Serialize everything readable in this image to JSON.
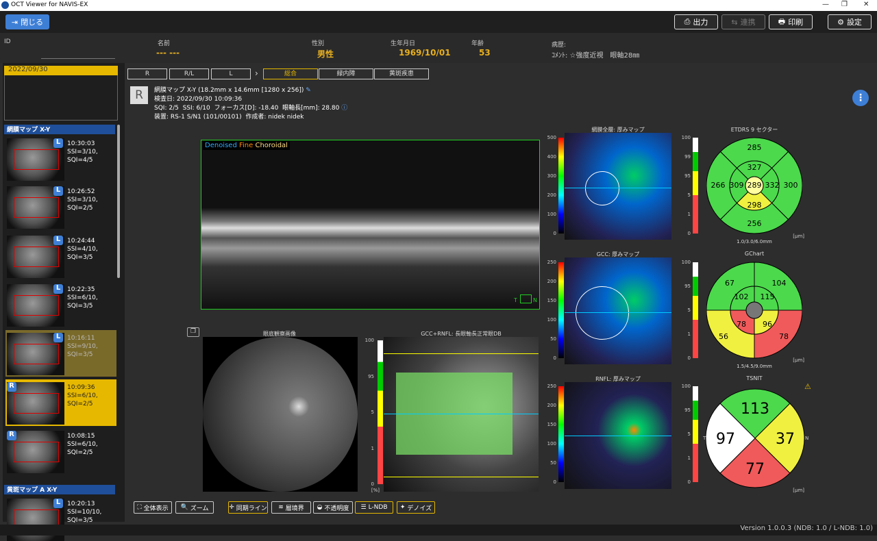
{
  "window": {
    "title": "OCT Viewer for NAVIS-EX"
  },
  "toolbar": {
    "close": "閉じる",
    "output": "出力",
    "link": "連携",
    "print": "印刷",
    "settings": "設定"
  },
  "patient": {
    "id_label": "ID",
    "name_label": "名前",
    "name": "--- ---",
    "sex_label": "性別",
    "sex": "男性",
    "dob_label": "生年月日",
    "dob": "1969/10/01",
    "age_label": "年齢",
    "age": "53",
    "history_label": "病歴:",
    "comment": "ｺﾒﾝﾄ: ☆強度近視　眼軸28㎜"
  },
  "sidebar": {
    "date": "2022/09/30",
    "section1": "網膜マップ X-Y",
    "section2": "黄斑マップ A X-Y",
    "thumbs": [
      {
        "eye": "L",
        "time": "10:30:03",
        "ssi": "SSI=3/10,",
        "sqi": "SQI=4/5"
      },
      {
        "eye": "L",
        "time": "10:26:52",
        "ssi": "SSI=3/10,",
        "sqi": "SQI=2/5"
      },
      {
        "eye": "L",
        "time": "10:24:44",
        "ssi": "SSI=4/10,",
        "sqi": "SQI=3/5"
      },
      {
        "eye": "L",
        "time": "10:22:35",
        "ssi": "SSI=6/10,",
        "sqi": "SQI=3/5"
      },
      {
        "eye": "L",
        "time": "10:16:11",
        "ssi": "SSI=9/10,",
        "sqi": "SQI=3/5"
      },
      {
        "eye": "R",
        "time": "10:09:36",
        "ssi": "SSI=6/10,",
        "sqi": "SQI=2/5"
      },
      {
        "eye": "R",
        "time": "10:08:15",
        "ssi": "SSI=6/10,",
        "sqi": "SQI=2/5"
      },
      {
        "eye": "L",
        "time": "10:20:13",
        "ssi": "SSI=10/10,",
        "sqi": "SQI=3/5"
      }
    ]
  },
  "tabs": {
    "r": "R",
    "rl": "R/L",
    "l": "L",
    "sep": "›",
    "summary": "総合",
    "glaucoma": "緑内障",
    "macula": "黄斑疾患"
  },
  "scan": {
    "eye": "R",
    "title": "網膜マップ X-Y (18.2mm x 14.6mm [1280 x 256])",
    "date": "検査日: 2022/09/30 10:09:36",
    "q1": "SQI: 2/5",
    "q2": "SSI: 6/10",
    "q3": "フォーカス[D]: -18.40",
    "q4": "眼軸長[mm]: 28.80",
    "device": "装置: RS-1 S/N1 (101/00101)",
    "author": "作成者: nidek nidek"
  },
  "bscan": {
    "t1": "Denoised",
    "t2": "Fine",
    "t3": "Choroidal",
    "t_label": "T",
    "n_label": "N"
  },
  "panels": {
    "fundus": "眼底観察画像",
    "gcc_rnfl": "GCC+RNFL: 長眼軸長正常眼DB",
    "full": "網膜全層: 厚みマップ",
    "gcc": "GCC: 厚みマップ",
    "rnfl": "RNFL: 厚みマップ",
    "etdrs": "ETDRS 9 セクター",
    "gchart": "GChart",
    "tsnit": "TSNIT"
  },
  "ticks": {
    "full": [
      "500",
      "400",
      "300",
      "200",
      "100",
      "0"
    ],
    "gcc": [
      "250",
      "200",
      "150",
      "100",
      "50",
      "0"
    ],
    "rnfl": [
      "250",
      "200",
      "150",
      "100",
      "50",
      "0"
    ],
    "pct": [
      "100",
      "99",
      "95",
      "5",
      "1",
      "0"
    ],
    "pct2": [
      "100",
      "95",
      "5",
      "1",
      "0"
    ],
    "um": "[μm]",
    "pc": "[%]"
  },
  "etdrs": {
    "values": [
      "285",
      "327",
      "266",
      "309",
      "289",
      "332",
      "300",
      "298",
      "256"
    ],
    "note": "1.0/3.0/6.0mm",
    "unit": "[μm]"
  },
  "gchart": {
    "values": [
      "67",
      "104",
      "102",
      "115",
      "78",
      "96",
      "56",
      "78"
    ],
    "note": "1.5/4.5/9.0mm",
    "unit": "[μm]"
  },
  "tsnit": {
    "values": [
      "113",
      "97",
      "37",
      "77"
    ],
    "t": "T",
    "n": "N",
    "unit": "[μm]"
  },
  "colors": {
    "green": "#4cd94c",
    "yellow": "#f0f040",
    "red": "#f05a5a",
    "white": "#ffffff",
    "accent": "#e6b800",
    "blue": "#3e7fd6"
  },
  "bottom": {
    "full": "全体表示",
    "zoom": "ズーム",
    "sync": "同期ライン",
    "layer": "層境界",
    "opacity": "不透明度",
    "lndb": "L-NDB",
    "denoise": "デノイズ"
  },
  "status": "Version 1.0.0.3 (NDB: 1.0 / L-NDB: 1.0)"
}
